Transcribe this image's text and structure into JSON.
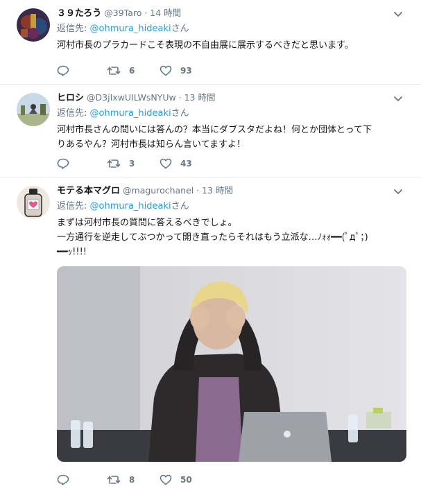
{
  "tweets": [
    {
      "name": "３９たろう",
      "handle": "@39Taro",
      "separator": "·",
      "time": "14 時間",
      "reply_prefix": "返信先: ",
      "reply_mention": "@ohmura_hideaki",
      "reply_suffix": "さん",
      "text": "河村市長のプラカードこそ表現の不自由展に展示するべきだと思います。",
      "retweets": "6",
      "likes": "93"
    },
    {
      "name": "ヒロシ",
      "handle": "@D3jIxwUILWsNYUw",
      "separator": "·",
      "time": "13 時間",
      "reply_prefix": "返信先: ",
      "reply_mention": "@ohmura_hideaki",
      "reply_suffix": "さん",
      "text": "河村市長さんの問いには答んの？本当にダブスタだよね！何とか団体とって下\nりあるやん？河村市長は知らん言いてますよ！",
      "retweets": "3",
      "likes": "43"
    },
    {
      "name": "モテる本マグロ",
      "handle": "@magurochanel",
      "separator": "·",
      "time": "13 時間",
      "reply_prefix": "返信先: ",
      "reply_mention": "@ohmura_hideaki",
      "reply_suffix": "さん",
      "text": "まずは河村市長の質問に答えるべきでしょ。\n一方通行を逆走してぶつかって開き直ったらそれはもう立派な…ﾉｫｫ━━(ﾟдﾟ；)\n━━ｯ!!!!",
      "retweets": "8",
      "likes": "50"
    }
  ],
  "icons": {
    "reply": "reply-icon",
    "retweet": "retweet-icon",
    "like": "heart-icon",
    "more": "chevron-down-icon"
  },
  "colors": {
    "link": "#1da1f2",
    "secondary": "#657786",
    "border": "#e6ecf0"
  }
}
